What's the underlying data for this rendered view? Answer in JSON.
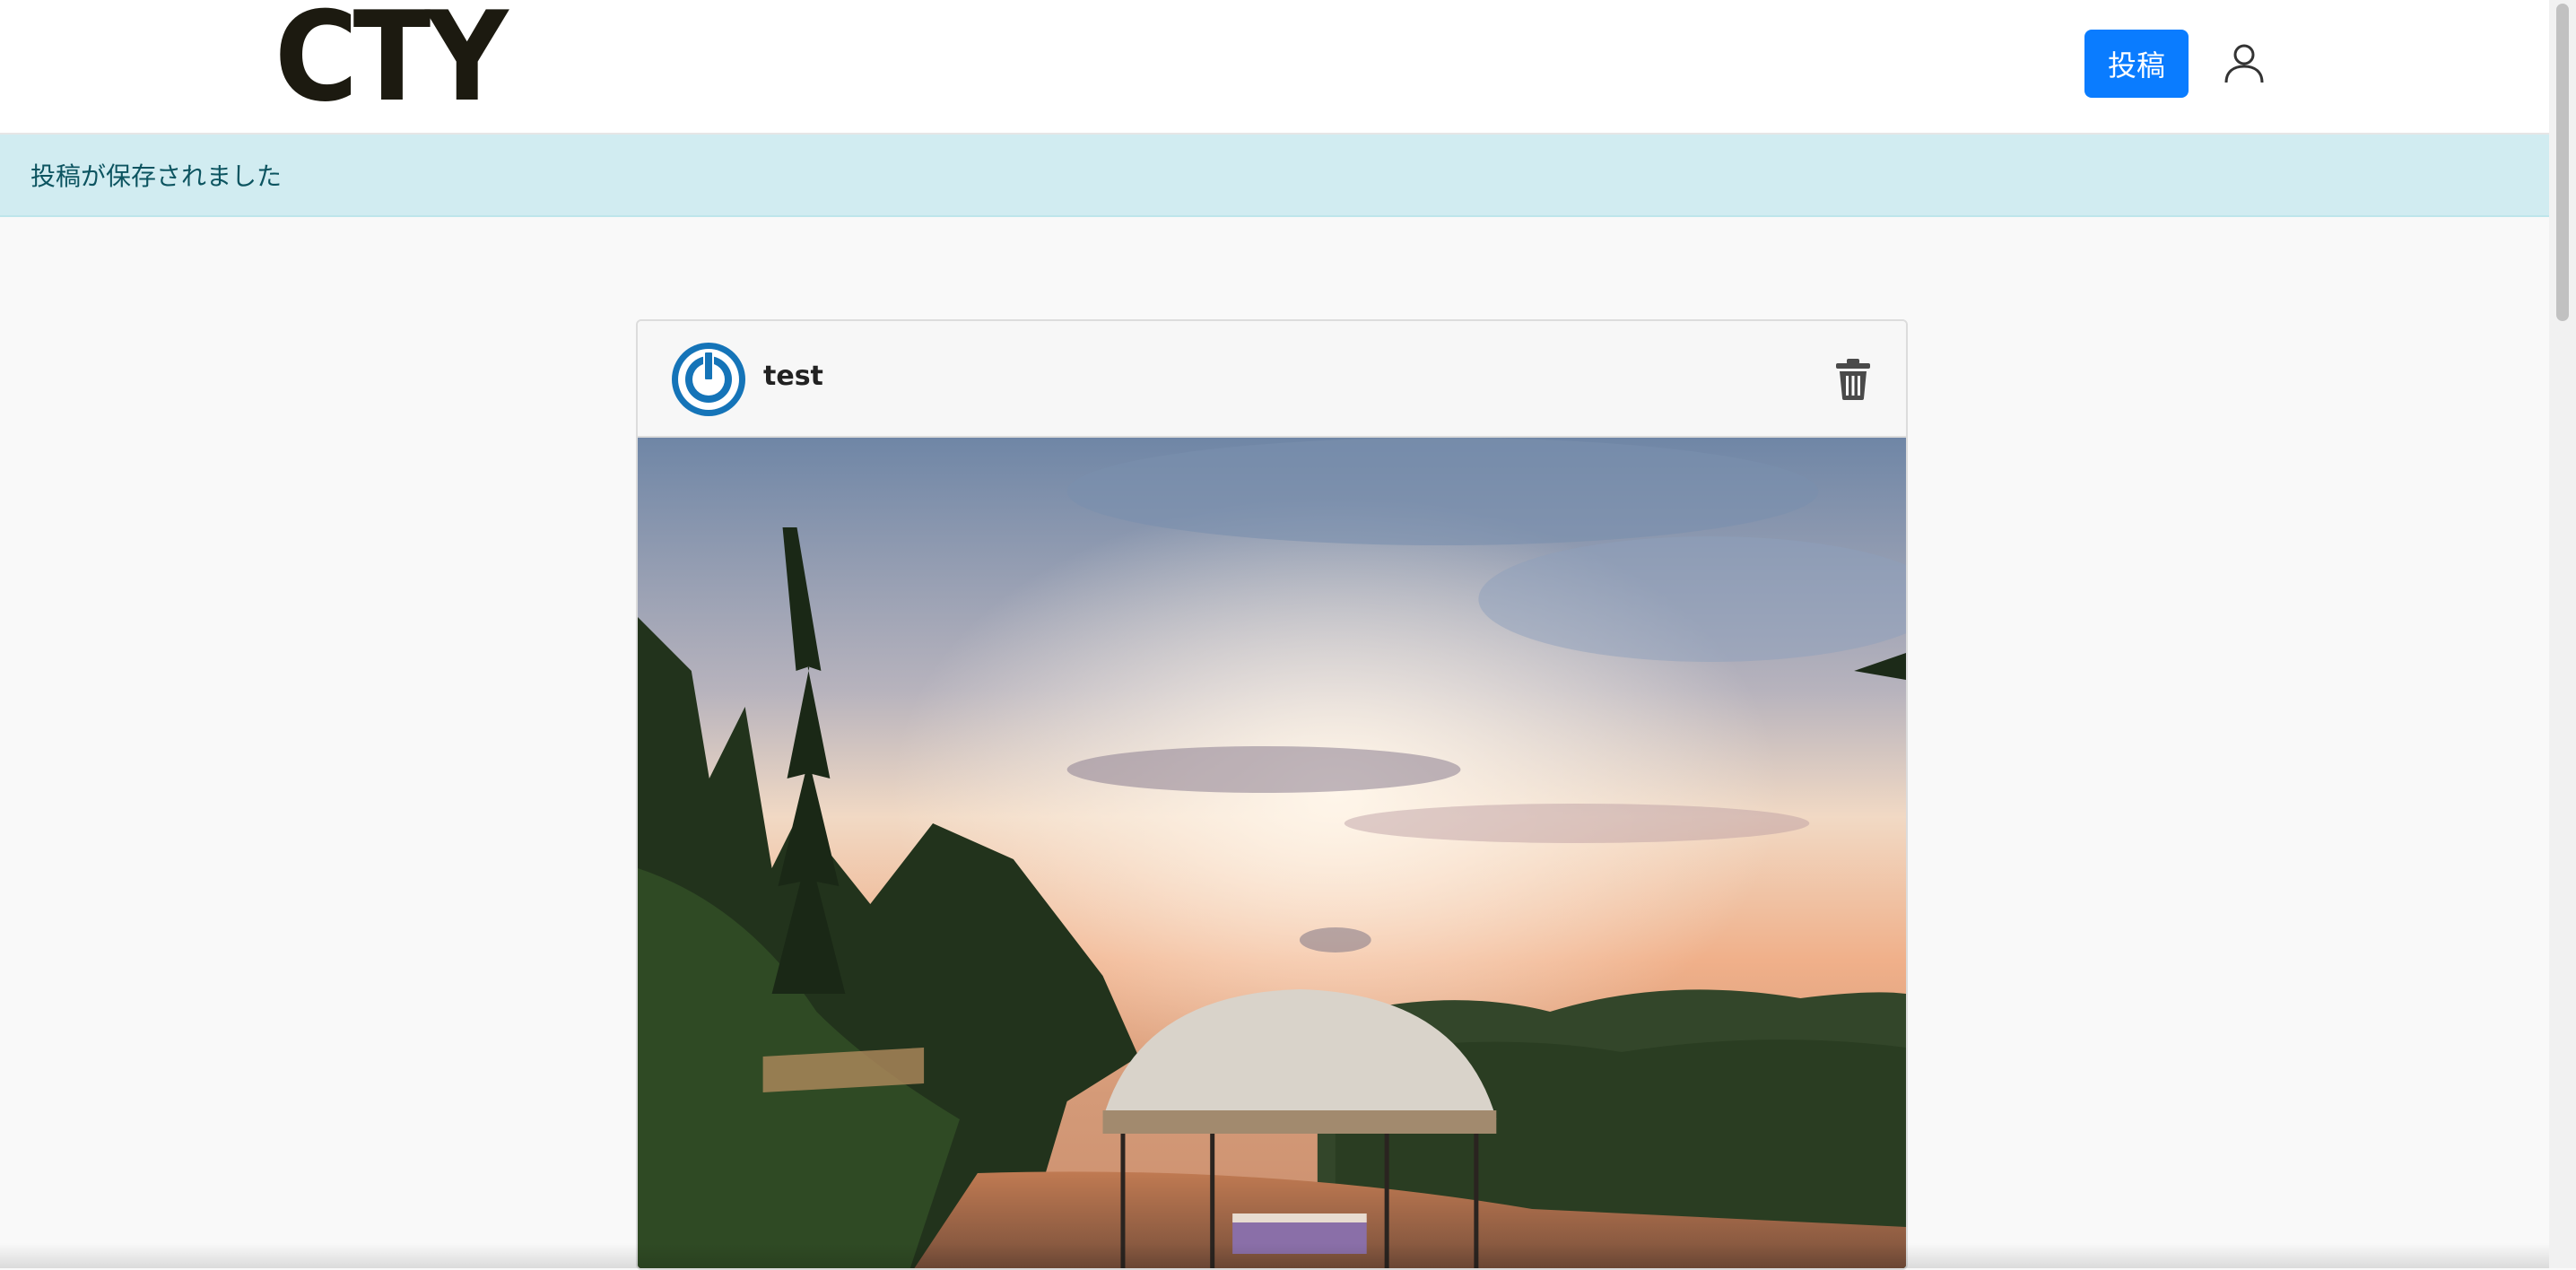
{
  "navbar": {
    "logo_text": "CTY",
    "post_button_label": "投稿",
    "user_icon": "user-icon"
  },
  "flash": {
    "message": "投稿が保存されました",
    "color": "#0c5460",
    "background": "#d1ecf1"
  },
  "post": {
    "username": "test",
    "avatar_icon": "power-icon",
    "delete_icon": "trash-icon",
    "image_subject": "sunset-gazebo-photo"
  },
  "colors": {
    "primary_button": "#0a7cff",
    "avatar_blue": "#1574b8"
  }
}
